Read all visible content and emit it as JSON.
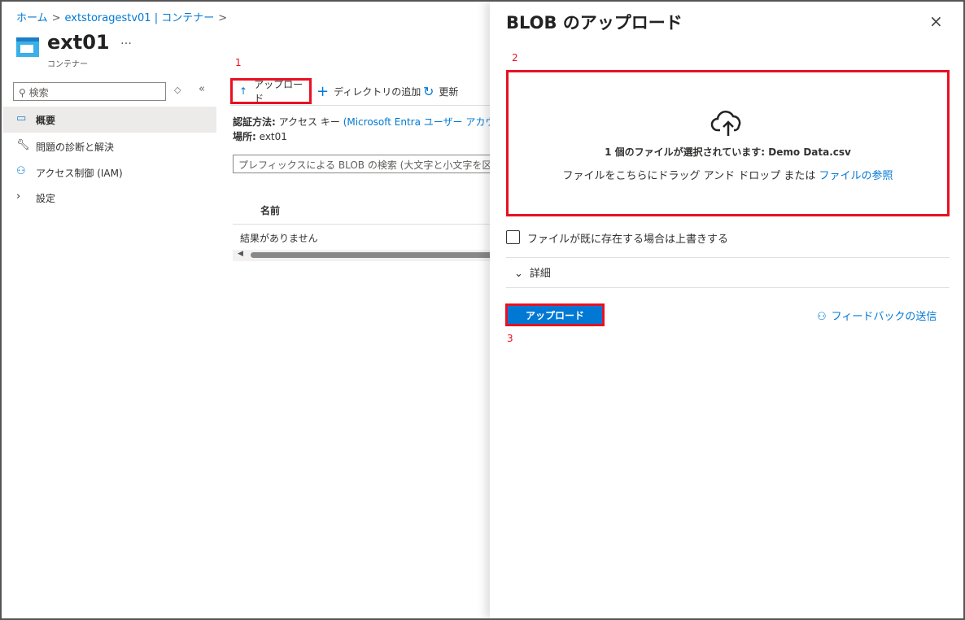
{
  "breadcrumb": [
    "ホーム",
    "extstoragestv01 | コンテナー"
  ],
  "header": {
    "title": "ext01",
    "subtitle": "コンテナー",
    "more": "…"
  },
  "sidebar": {
    "search_placeholder": "検索",
    "items": [
      {
        "label": "概要"
      },
      {
        "label": "問題の診断と解決"
      },
      {
        "label": "アクセス制御 (IAM)"
      },
      {
        "label": "設定"
      }
    ]
  },
  "toolbar": {
    "upload": "アップロード",
    "add_directory": "ディレクトリの追加",
    "refresh": "更新"
  },
  "annotations": [
    "1",
    "2",
    "3"
  ],
  "info": {
    "auth_label": "認証方法:",
    "auth_value": "アクセス キー",
    "auth_link": "(Microsoft Entra ユーザー アカウ",
    "location_label": "場所:",
    "location_value": "ext01"
  },
  "blob_search_placeholder": "プレフィックスによる BLOB の検索 (大文字と小文字を区別)",
  "table": {
    "column": "名前",
    "empty": "結果がありません"
  },
  "panel": {
    "title": "BLOB のアップロード",
    "selected_prefix": "1 個のファイルが選択されています:",
    "selected_file": "Demo Data.csv",
    "drop_text": "ファイルをこちらにドラッグ アンド ドロップ または",
    "browse_link": "ファイルの参照",
    "overwrite_label": "ファイルが既に存在する場合は上書きする",
    "overwrite_checked": false,
    "details": "詳細",
    "upload_button": "アップロード",
    "feedback": "フィードバックの送信"
  }
}
